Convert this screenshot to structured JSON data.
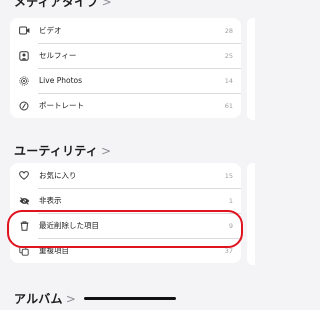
{
  "media_types": {
    "title": "メディアタイプ",
    "chevron": ">",
    "items": [
      {
        "label": "ビデオ",
        "count": "28",
        "icon": "video-icon"
      },
      {
        "label": "セルフィー",
        "count": "25",
        "icon": "selfie-icon"
      },
      {
        "label": "Live Photos",
        "count": "14",
        "icon": "live-photo-icon"
      },
      {
        "label": "ポートレート",
        "count": "61",
        "icon": "portrait-icon"
      }
    ]
  },
  "utilities": {
    "title": "ユーティリティ",
    "chevron": ">",
    "items": [
      {
        "label": "お気に入り",
        "count": "15",
        "icon": "heart-icon"
      },
      {
        "label": "非表示",
        "count": "1",
        "icon": "eye-slash-icon"
      },
      {
        "label": "最近削除した項目",
        "count": "9",
        "icon": "trash-icon"
      },
      {
        "label": "重複項目",
        "count": "37",
        "icon": "duplicate-icon"
      }
    ]
  },
  "albums": {
    "title": "アルバム",
    "chevron": ">"
  },
  "highlight_color": "#e0141e"
}
